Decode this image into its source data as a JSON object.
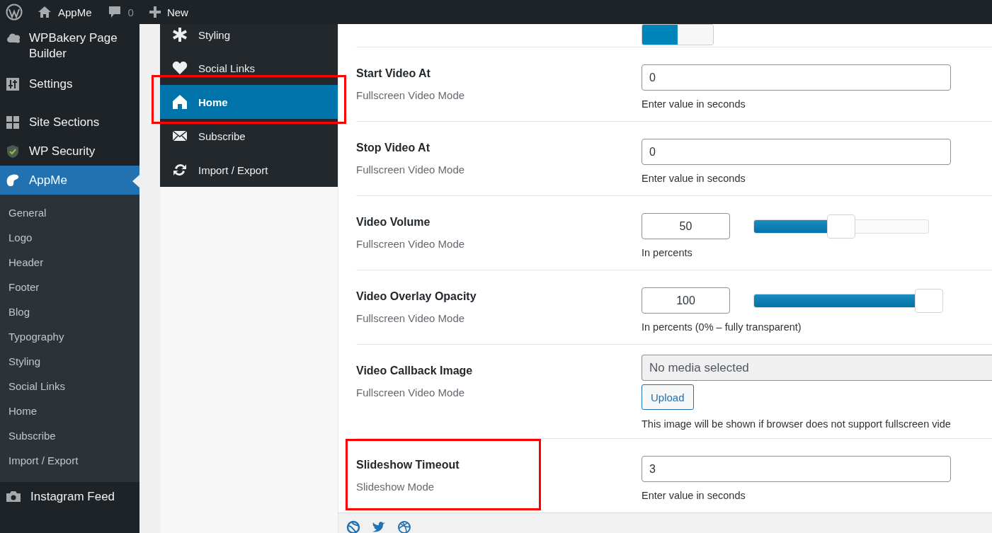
{
  "admin_bar": {
    "site": "AppMe",
    "comments": "0",
    "new": "New"
  },
  "admin_menu": {
    "items": [
      {
        "label": "WPBakery Page Builder",
        "selected": false
      },
      {
        "label": "Settings",
        "selected": false
      },
      {
        "label": "Site Sections",
        "selected": false
      },
      {
        "label": "WP Security",
        "selected": false
      },
      {
        "label": "AppMe",
        "selected": true
      }
    ],
    "submenu": [
      "General",
      "Logo",
      "Header",
      "Footer",
      "Blog",
      "Typography",
      "Styling",
      "Social Links",
      "Home",
      "Subscribe",
      "Import / Export"
    ],
    "after": [
      {
        "label": "Instagram Feed",
        "selected": false
      }
    ]
  },
  "options_nav": [
    {
      "label": "Styling",
      "selected": false,
      "highlighted": false
    },
    {
      "label": "Social Links",
      "selected": false,
      "highlighted": false
    },
    {
      "label": "Home",
      "selected": true,
      "highlighted": true
    },
    {
      "label": "Subscribe",
      "selected": false,
      "highlighted": false
    },
    {
      "label": "Import / Export",
      "selected": false,
      "highlighted": false
    }
  ],
  "top_toggle": {
    "on": true
  },
  "rows": [
    {
      "kind": "text",
      "title": "Start Video At",
      "subtitle": "Fullscreen Video Mode",
      "value": "0",
      "hint": "Enter value in seconds",
      "highlighted": false
    },
    {
      "kind": "text",
      "title": "Stop Video At",
      "subtitle": "Fullscreen Video Mode",
      "value": "0",
      "hint": "Enter value in seconds",
      "highlighted": false
    },
    {
      "kind": "slider",
      "title": "Video Volume",
      "subtitle": "Fullscreen Video Mode",
      "value": "50",
      "level": 0.5,
      "hint": "In percents",
      "highlighted": false
    },
    {
      "kind": "slider",
      "title": "Video Overlay Opacity",
      "subtitle": "Fullscreen Video Mode",
      "value": "100",
      "level": 1,
      "hint": "In percents (0% – fully transparent)",
      "highlighted": false
    },
    {
      "kind": "media",
      "title": "Video Callback Image",
      "subtitle": "Fullscreen Video Mode",
      "value": "No media selected",
      "button": "Upload",
      "hint": "This image will be shown if browser does not support fullscreen vide",
      "highlighted": false
    },
    {
      "kind": "text",
      "title": "Slideshow Timeout",
      "subtitle": "Slideshow Mode",
      "value": "3",
      "hint": "Enter value in seconds",
      "highlighted": true
    }
  ]
}
